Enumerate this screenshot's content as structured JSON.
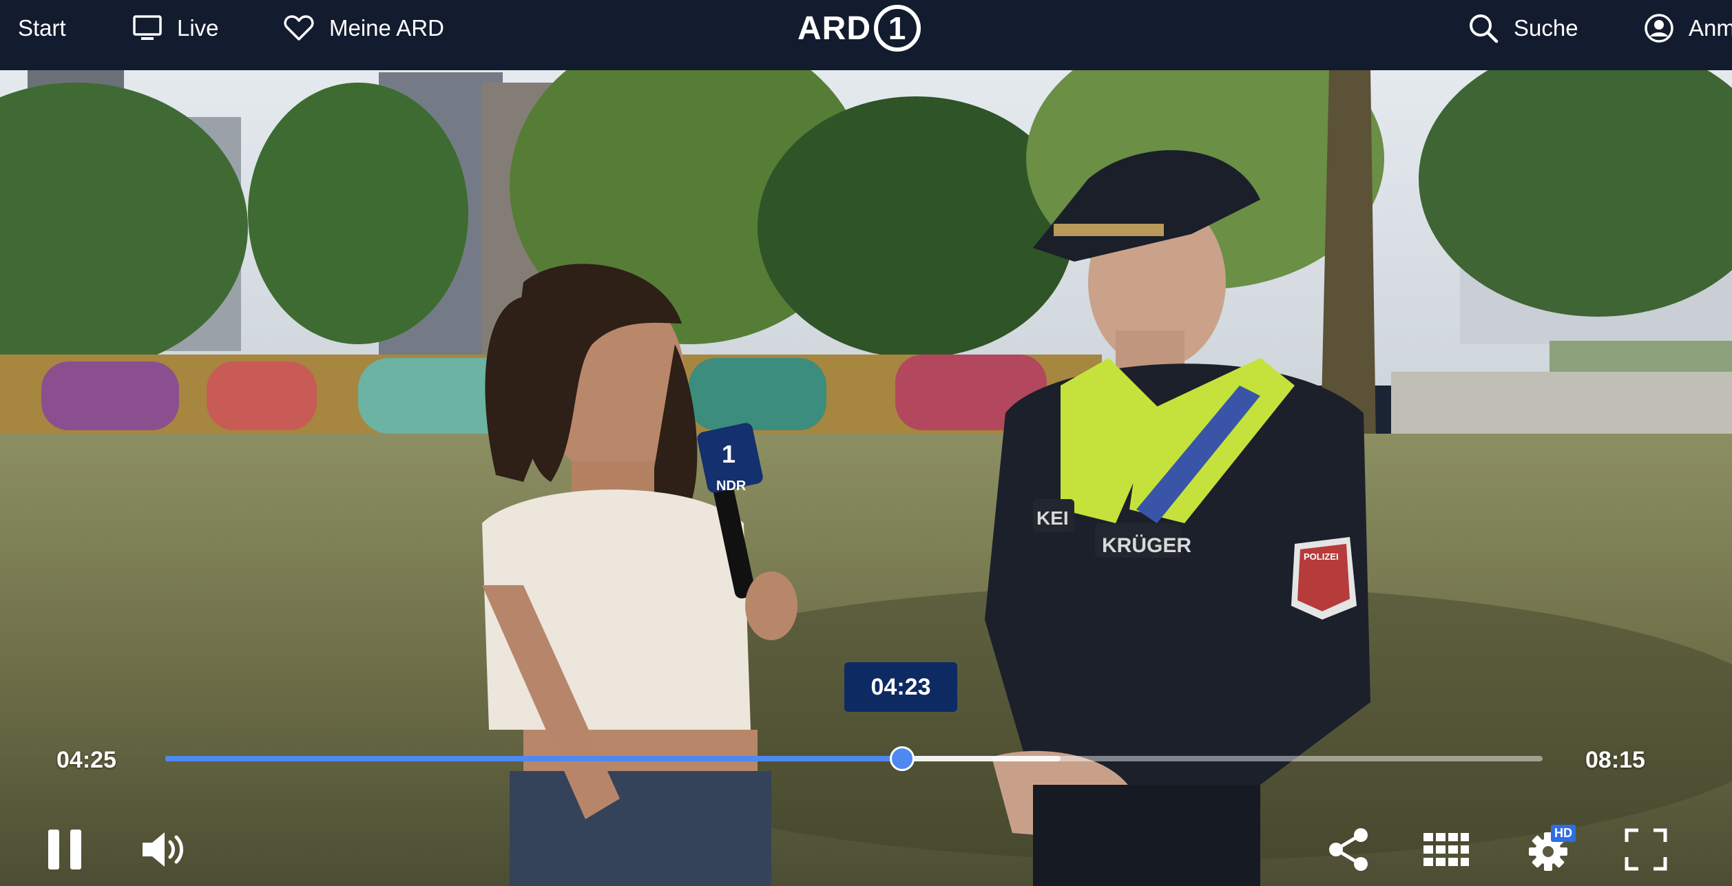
{
  "nav": {
    "start": "Start",
    "live": "Live",
    "meine_ard": "Meine ARD",
    "logo_text": "ARD",
    "logo_mark": "1",
    "search": "Suche",
    "account": "Anm"
  },
  "player": {
    "current_time": "04:25",
    "duration": "08:15",
    "hover_time": "04:23",
    "progress_fraction": 0.535,
    "buffered_fraction": 0.65,
    "hover_fraction": 0.534,
    "state": "playing"
  },
  "scene": {
    "badge_text": "POLIZEI",
    "name_tag": "KRÜGER",
    "vest_text": "KEI",
    "mic_logo": "1",
    "mic_label": "NDR"
  },
  "icons": {
    "live": "tv-icon",
    "meine_ard": "heart-icon",
    "search": "search-icon",
    "account": "user-icon",
    "pause": "pause-icon",
    "volume": "volume-icon",
    "share": "share-icon",
    "chapters": "grid-icon",
    "settings": "gear-icon",
    "fullscreen": "fullscreen-icon"
  },
  "settings_badge": "HD",
  "colors": {
    "accent": "#4e88f0",
    "nav_bg": "#131c2e",
    "tooltip_bg": "#0d2a63"
  }
}
